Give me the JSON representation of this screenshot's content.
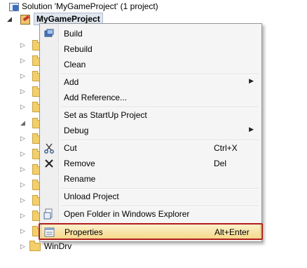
{
  "solution_explorer": {
    "solution_label": "Solution 'MyGameProject' (1 project)",
    "project_label": "MyGameProject",
    "last_folder_label": "WinDrv"
  },
  "context_menu": {
    "items": [
      {
        "label": "Build",
        "icon": "build-icon"
      },
      {
        "label": "Rebuild"
      },
      {
        "label": "Clean"
      },
      {
        "label": "Add",
        "submenu": true
      },
      {
        "label": "Add Reference..."
      },
      {
        "label": "Set as StartUp Project"
      },
      {
        "label": "Debug",
        "submenu": true
      },
      {
        "label": "Cut",
        "shortcut": "Ctrl+X",
        "icon": "scissors-icon"
      },
      {
        "label": "Remove",
        "shortcut": "Del",
        "icon": "close-icon"
      },
      {
        "label": "Rename"
      },
      {
        "label": "Unload Project"
      },
      {
        "label": "Open Folder in Windows Explorer",
        "icon": "folder-open-icon"
      },
      {
        "label": "Properties",
        "shortcut": "Alt+Enter",
        "icon": "properties-icon",
        "highlighted": true
      }
    ]
  },
  "colors": {
    "highlight_border": "#b21d1d",
    "hover_fill": "#f6d98b"
  }
}
